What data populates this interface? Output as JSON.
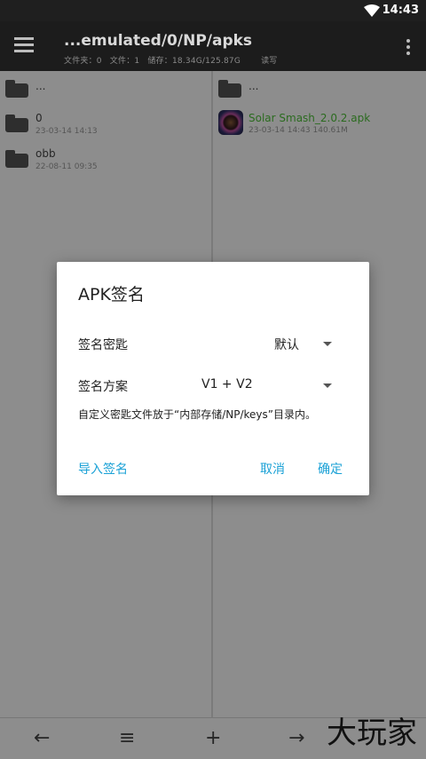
{
  "status": {
    "time": "14:43"
  },
  "toolbar": {
    "title": "...emulated/0/NP/apks",
    "stats": [
      "文件夹：0",
      "文件：1",
      "储存：18.34G/125.87G",
      "读写"
    ]
  },
  "left_pane": {
    "parent": "...",
    "items": [
      {
        "name": "0",
        "meta": "23-03-14 14:13"
      },
      {
        "name": "obb",
        "meta": "22-08-11 09:35"
      }
    ]
  },
  "right_pane": {
    "parent": "...",
    "items": [
      {
        "name": "Solar Smash_2.0.2.apk",
        "meta": "23-03-14 14:43  140.61M"
      }
    ]
  },
  "dialog": {
    "title": "APK签名",
    "key_label": "签名密匙",
    "key_value": "默认",
    "scheme_label": "签名方案",
    "scheme_value": "V1 + V2",
    "note": "自定义密匙文件放于“内部存储/NP/keys”目录内。",
    "import_button": "导入签名",
    "cancel_button": "取消",
    "ok_button": "确定"
  },
  "navbar": {
    "back": "←",
    "list": "≡",
    "add": "+",
    "forward": "→"
  },
  "watermark": "大玩家"
}
